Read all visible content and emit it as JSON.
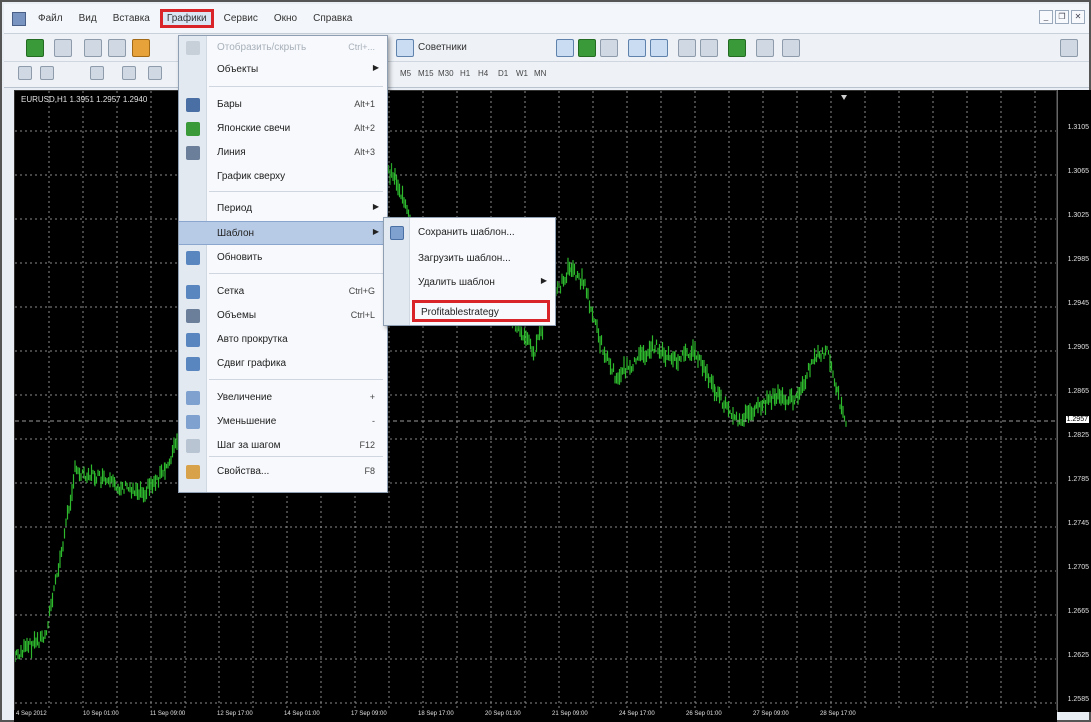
{
  "menubar": {
    "items": [
      "Файл",
      "Вид",
      "Вставка",
      "Графики",
      "Сервис",
      "Окно",
      "Справка"
    ],
    "active_index": 3,
    "window_controls": [
      "minimize",
      "restore",
      "close"
    ]
  },
  "toolbar": {
    "advisors_label": "Советники",
    "timeframes": [
      "M5",
      "M15",
      "M30",
      "H1",
      "H4",
      "D1",
      "W1",
      "MN"
    ]
  },
  "chart": {
    "info": "EURUSD,H1  1.3951 1.2957 1.2940",
    "bg_color": "#000000",
    "line_color": "#2db82d",
    "grid_color": "#8a8a8a",
    "price_labels": [
      "1.3105",
      "1.3065",
      "1.3025",
      "1.2985",
      "1.2945",
      "1.2905",
      "1.2865",
      "1.2825",
      "1.2785",
      "1.2745",
      "1.2705",
      "1.2665",
      "1.2625",
      "1.2585"
    ],
    "current_price": "1.2957",
    "time_labels": [
      "4 Sep 2012",
      "10 Sep 01:00",
      "11 Sep 09:00",
      "12 Sep 17:00",
      "14 Sep 01:00",
      "17 Sep 09:00",
      "18 Sep 17:00",
      "20 Sep 01:00",
      "21 Sep 09:00",
      "24 Sep 17:00",
      "26 Sep 01:00",
      "27 Sep 09:00",
      "28 Sep 17:00"
    ]
  },
  "charts_menu": {
    "items": [
      {
        "label": "Отобразить/скрыть",
        "shortcut": "Ctrl+...",
        "disabled": true,
        "icon": "chart-visibility-icon"
      },
      {
        "label": "Объекты",
        "submenu": true,
        "icon": ""
      },
      {
        "label": "Бары",
        "shortcut": "Alt+1",
        "icon": "bar-chart-icon"
      },
      {
        "label": "Японские свечи",
        "shortcut": "Alt+2",
        "icon": "candlestick-icon"
      },
      {
        "label": "Линия",
        "shortcut": "Alt+3",
        "icon": "line-chart-icon"
      },
      {
        "label": "График сверху",
        "icon": ""
      },
      {
        "label": "Период",
        "submenu": true,
        "icon": ""
      },
      {
        "label": "Шаблон",
        "submenu": true,
        "highlighted": true,
        "icon": ""
      },
      {
        "label": "Обновить",
        "icon": "refresh-icon"
      },
      {
        "label": "Сетка",
        "shortcut": "Ctrl+G",
        "icon": "grid-icon"
      },
      {
        "label": "Объемы",
        "shortcut": "Ctrl+L",
        "icon": "volumes-icon"
      },
      {
        "label": "Авто прокрутка",
        "icon": "autoscroll-icon"
      },
      {
        "label": "Сдвиг графика",
        "icon": "chart-shift-icon"
      },
      {
        "label": "Увеличение",
        "shortcut": "+",
        "icon": "zoom-in-icon"
      },
      {
        "label": "Уменьшение",
        "shortcut": "-",
        "icon": "zoom-out-icon"
      },
      {
        "label": "Шаг за шагом",
        "shortcut": "F12",
        "icon": "step-icon"
      },
      {
        "label": "Свойства...",
        "shortcut": "F8",
        "icon": "properties-icon"
      }
    ]
  },
  "template_submenu": {
    "items": [
      {
        "label": "Сохранить шаблон...",
        "icon": "save-template-icon"
      },
      {
        "label": "Загрузить шаблон...",
        "icon": ""
      },
      {
        "label": "Удалить шаблон",
        "submenu": true,
        "icon": ""
      },
      {
        "label": "Profitablestrategy",
        "boxed": true,
        "icon": ""
      }
    ]
  }
}
